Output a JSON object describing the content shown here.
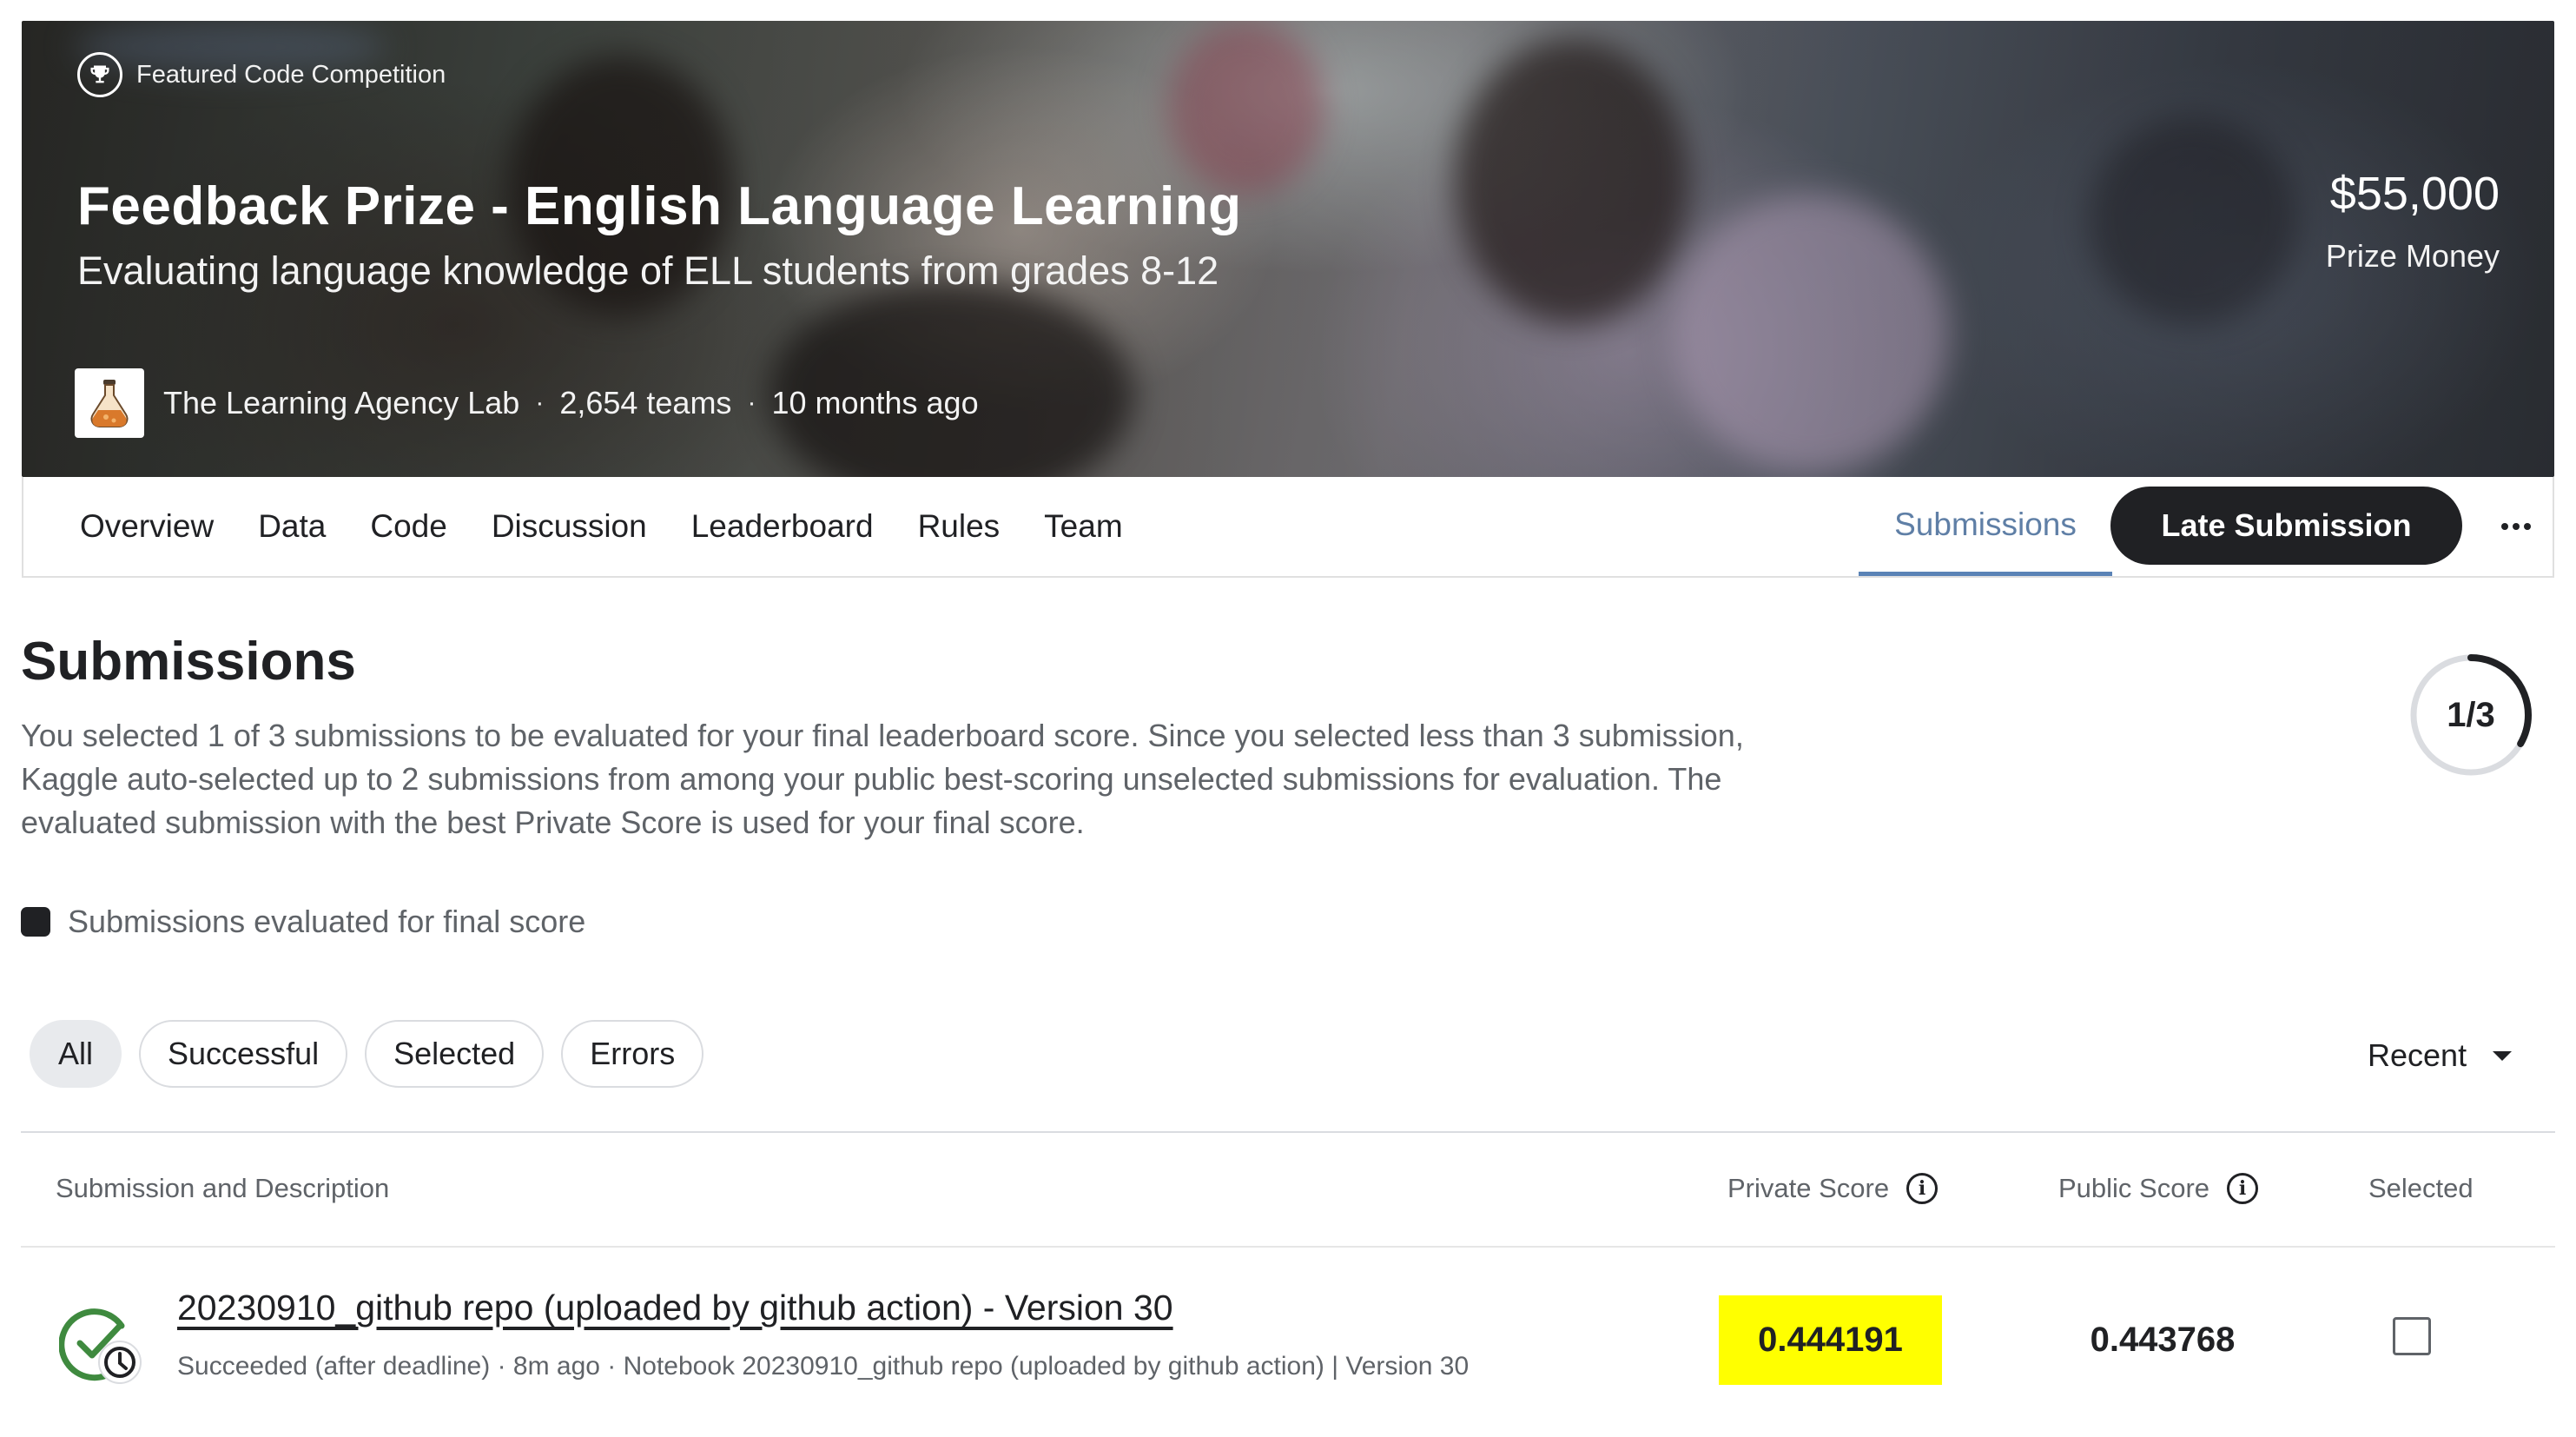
{
  "hero": {
    "badge_label": "Featured Code Competition",
    "title": "Feedback Prize - English Language Learning",
    "subtitle": "Evaluating language knowledge of ELL students from grades 8-12",
    "host": "The Learning Agency Lab",
    "teams": "2,654 teams",
    "age": "10 months ago",
    "separator": "·",
    "prize_amount": "$55,000",
    "prize_label": "Prize Money"
  },
  "nav": {
    "tabs": [
      "Overview",
      "Data",
      "Code",
      "Discussion",
      "Leaderboard",
      "Rules",
      "Team"
    ],
    "active_tab": "Submissions",
    "late_submission_label": "Late Submission"
  },
  "submissions": {
    "title": "Submissions",
    "description": "You selected 1 of 3 submissions to be evaluated for your final leaderboard score. Since you selected less than 3 submission, Kaggle auto-selected up to 2 submissions from among your public best-scoring unselected submissions for evaluation. The evaluated submission with the best Private Score is used for your final score.",
    "progress_text": "1/3",
    "progress_fraction": 0.3333,
    "legend_label": "Submissions evaluated for final score"
  },
  "filters": {
    "chips": [
      "All",
      "Successful",
      "Selected",
      "Errors"
    ],
    "active_chip": "All",
    "sort_label": "Recent"
  },
  "table": {
    "headers": {
      "submission": "Submission and Description",
      "private_score": "Private Score",
      "public_score": "Public Score",
      "selected": "Selected"
    },
    "rows": [
      {
        "title": "20230910_github repo (uploaded by github action) - Version 30",
        "meta": "Succeeded (after deadline) · 8m ago · Notebook 20230910_github repo (uploaded by github action) | Version 30",
        "private_score": "0.444191",
        "public_score": "0.443768",
        "selected": false
      }
    ]
  },
  "colors": {
    "accent": "#5a83b6",
    "highlight": "#ffff00",
    "success": "#3f8a3f",
    "dark": "#202124"
  }
}
